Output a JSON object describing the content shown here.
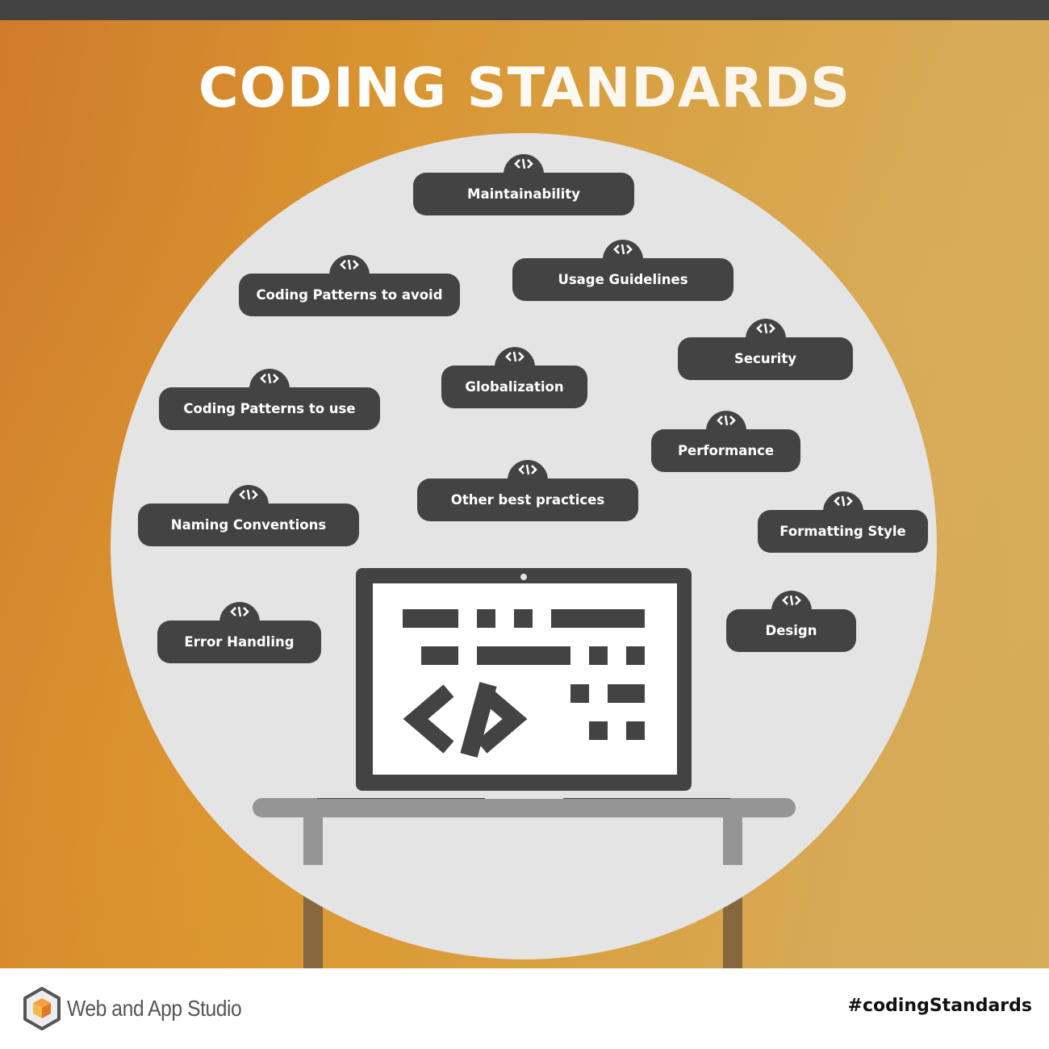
{
  "title": "CODING STANDARDS",
  "colors": {
    "badge_bg": "#434343",
    "circle_bg": "#e4e4e4",
    "background_gradient_start": "#cf7c2c",
    "background_gradient_end": "#d6ad5b",
    "table_gray": "#959595"
  },
  "badge_icon": "code-tag-icon",
  "topics": [
    {
      "label": "Maintainability"
    },
    {
      "label": "Usage Guidelines"
    },
    {
      "label": "Coding Patterns to avoid"
    },
    {
      "label": "Security"
    },
    {
      "label": "Globalization"
    },
    {
      "label": "Coding Patterns to use"
    },
    {
      "label": "Performance"
    },
    {
      "label": "Other best practices"
    },
    {
      "label": "Naming Conventions"
    },
    {
      "label": "Formatting Style"
    },
    {
      "label": "Design"
    },
    {
      "label": "Error Handling"
    }
  ],
  "illustration": {
    "laptop_icon": "laptop-icon",
    "screen_icon": "code-brackets-icon",
    "desk_icon": "desk-icon"
  },
  "footer": {
    "brand_name": "Web and App Studio",
    "brand_logo": "hexagon-cube-logo",
    "hashtag": "#codingStandards"
  }
}
